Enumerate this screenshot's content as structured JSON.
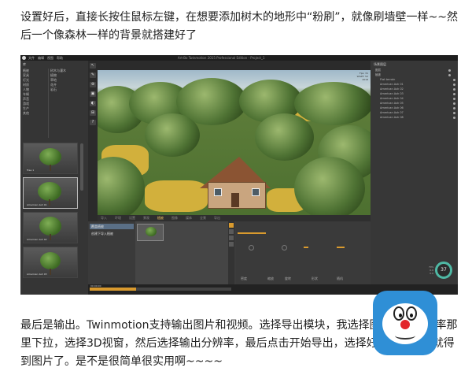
{
  "article": {
    "p1": "设置好后，直接长按住鼠标左键，在想要添加树木的地形中“粉刷”，就像刷墙壁一样~~然后一个像森林一样的背景就搭建好了",
    "p2": "最后是输出。Twinmotion支持输出图片和视频。选择导出模块，我选择图像，在分辨率那里下拉，选择3D视窗，然后选择输出分辨率，最后点击开始导出，选择好保存位置后就得到图片了。是不是很简单很实用啊~~~~"
  },
  "app": {
    "title": "Art-Bo Twinmotion 2015 Professional Edition - Project_1",
    "menu": [
      "文件",
      "编辑",
      "视图",
      "帮助"
    ],
    "left_panel": {
      "tab": "库",
      "col1": [
        "植被",
        "家具",
        "灯光",
        "材质",
        "人物",
        "车辆",
        "声音",
        "游戏",
        "生产",
        "其他"
      ],
      "col2": [
        "树木与灌木",
        "植物",
        "草地",
        "花卉",
        "岩石"
      ],
      "thumb_labels": [
        "Tree 1",
        "American Ash 01",
        "American Ash 02",
        "American Ash 03"
      ]
    },
    "tools": [
      "↖",
      "✎",
      "⊕",
      "▣",
      "◐",
      "⊞",
      "?"
    ],
    "viewport_info": [
      "Fps: 31",
      "WGPT: 52",
      "2018"
    ],
    "bottom_tabs": [
      "导入",
      "环境",
      "设置",
      "景观",
      "植被",
      "图像",
      "媒体",
      "全景",
      "导出"
    ],
    "active_tab": "植被",
    "bottom_list": [
      "覆盖植被",
      "创建下导入植被"
    ],
    "control_labels": [
      "密度",
      "缩放",
      "随机",
      "旋转",
      "形状"
    ],
    "status_text": "00:00:00",
    "right_panel": {
      "title": "场景图层",
      "rows": [
        "图层",
        "植被",
        "Flat terrain",
        "American Ash 01",
        "American Ash 02",
        "American Ash 03",
        "American Ash 04",
        "American Ash 05",
        "American Ash 06",
        "American Ash 07",
        "American Ash 08"
      ]
    },
    "perf_value": "37",
    "perf_text": [
      "FPS",
      "0.0",
      "0.0"
    ]
  },
  "progress": 0.33,
  "colors": {
    "accent": "#d99a2e",
    "panel": "#353535",
    "mascot": "#2f8fd6"
  }
}
